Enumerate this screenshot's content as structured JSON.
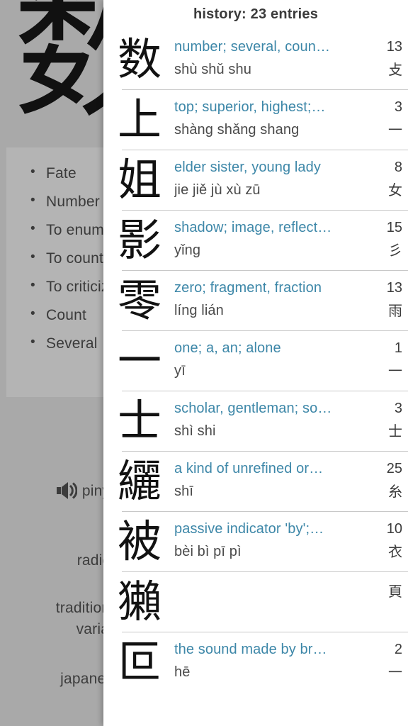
{
  "background": {
    "hero_character": "数",
    "meanings": [
      "Fate",
      "Number",
      "To enumerate",
      "To count",
      "To criticize",
      "Count",
      "Several"
    ],
    "fields": [
      {
        "label": "pinyin",
        "icon": "speaker-icon"
      },
      {
        "label": "radical"
      },
      {
        "label": "traditional"
      },
      {
        "label": "variant"
      },
      {
        "label": "japanese"
      }
    ],
    "pinyin_label": "pinyin",
    "radical_label": "radical",
    "traditional_label": "traditional",
    "variant_label": "variant",
    "japanese_label": "japanese"
  },
  "overlay": {
    "header": "history: 23 entries",
    "entry_count": "23",
    "accent_color": "#3d87a8",
    "entries": [
      {
        "character": "数",
        "definition": "number; several, coun…",
        "pinyin": "shù shǔ shu",
        "strokes": "13",
        "radical": "攴"
      },
      {
        "character": "上",
        "definition": "top; superior, highest;…",
        "pinyin": "shàng shǎng shang",
        "strokes": "3",
        "radical": "一"
      },
      {
        "character": "姐",
        "definition": "elder sister, young lady",
        "pinyin": "jie jiě jù xù zū",
        "strokes": "8",
        "radical": "女"
      },
      {
        "character": "影",
        "definition": "shadow; image, reflect…",
        "pinyin": "yǐng",
        "strokes": "15",
        "radical": "彡"
      },
      {
        "character": "零",
        "definition": "zero; fragment, fraction",
        "pinyin": "líng lián",
        "strokes": "13",
        "radical": "雨"
      },
      {
        "character": "一",
        "definition": "one; a, an; alone",
        "pinyin": "yī",
        "strokes": "1",
        "radical": "一"
      },
      {
        "character": "士",
        "definition": "scholar, gentleman; so…",
        "pinyin": "shì shi",
        "strokes": "3",
        "radical": "士"
      },
      {
        "character": "纚",
        "definition": "a kind of unrefined or…",
        "pinyin": "shī",
        "strokes": "25",
        "radical": "糸"
      },
      {
        "character": "被",
        "definition": "passive indicator 'by';…",
        "pinyin": "bèi bì pī pì",
        "strokes": "10",
        "radical": "衣"
      },
      {
        "character": "獺",
        "definition": "",
        "pinyin": "",
        "strokes": "",
        "radical": "頁"
      },
      {
        "character": "叵",
        "definition": "the sound made by br…",
        "pinyin": "hē",
        "strokes": "2",
        "radical": "一"
      }
    ]
  }
}
